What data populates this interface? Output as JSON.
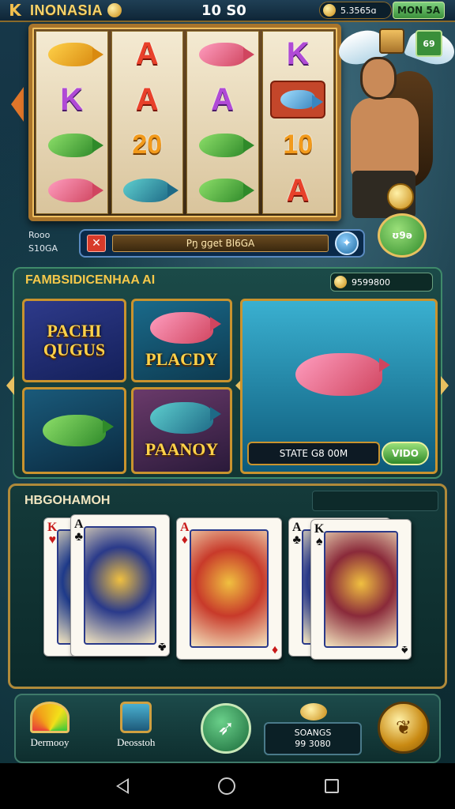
{
  "topbar": {
    "back_icon": "K",
    "brand": "INONASIA",
    "score": "10 S0",
    "balance": "5.3565ɑ",
    "menu_label": "MON 5A"
  },
  "slot": {
    "reels": [
      [
        "fish-gold",
        "K",
        "fish-green",
        "fish-pink"
      ],
      [
        "A",
        "A",
        "20",
        "fish-teal"
      ],
      [
        "fish-pink",
        "A",
        "fish-green",
        "fish-green"
      ],
      [
        "K",
        "fish-tile",
        "10",
        "A"
      ]
    ]
  },
  "side": {
    "bag_label": "69",
    "collect_label": "ʊ9ə"
  },
  "info": {
    "stats_line1": "Rooo",
    "stats_line2": "S10GA",
    "bet_text": "Pŋ ɡɡet Bl6GA"
  },
  "games": {
    "title": "FAMBSIDICENHAA AI",
    "coins": "9599800",
    "tile_a_label": "PACHI QUGUS",
    "tile_b_label": "PLACDY",
    "tile_d_label": "PAANOY",
    "big_status": "STATE G8 00M",
    "big_button": "VIDO"
  },
  "cards": {
    "title": "HBGOHAMOH",
    "items": [
      {
        "rank": "K",
        "suit": "♥",
        "suit_color": "red"
      },
      {
        "rank": "A",
        "suit": "♣",
        "suit_color": "black"
      },
      {
        "rank": "A",
        "suit": "♦",
        "suit_color": "red"
      },
      {
        "rank": "A",
        "suit": "♣",
        "suit_color": "black"
      },
      {
        "rank": "K",
        "suit": "♠",
        "suit_color": "black"
      }
    ]
  },
  "nav": {
    "item1_label": "Dermooy",
    "item2_label": "Deosstoh",
    "balance_line1": "SOANGS",
    "balance_line2": "99 3080"
  },
  "colors": {
    "gold": "#f5c84a",
    "panel": "#1b4a48",
    "accent_green": "#3a8f3a"
  }
}
